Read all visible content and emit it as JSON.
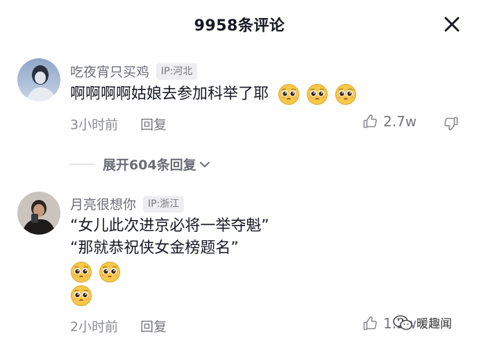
{
  "header": {
    "title": "9958条评论"
  },
  "comments": [
    {
      "username": "吃夜宵只买鸡",
      "ip": "IP:河北",
      "text": "啊啊啊啊姑娘去参加科举了耶",
      "time": "3小时前",
      "reply": "回复",
      "likes": "2.7w"
    },
    {
      "username": "月亮很想你",
      "ip": "IP:浙江",
      "line1": "“女儿此次进京必将一举夺魁”",
      "line2": "“那就恭祝侠女金榜题名”",
      "time": "2小时前",
      "reply": "回复",
      "likes": "1.2w"
    }
  ],
  "expand": {
    "label": "展开604条回复"
  },
  "watermark": {
    "text": "暖趣闻"
  },
  "icons": {
    "close": "close-icon",
    "like": "thumbs-up-icon",
    "dislike": "thumbs-down-icon",
    "emoji": "pleading-face-emoji-icon",
    "chevron": "chevron-down-icon",
    "watermark": "wechat-logo-icon"
  },
  "colors": {
    "text": "#161823",
    "secondary": "#75767e",
    "badge_bg": "#eeeef0",
    "emoji": "#f7c34a"
  }
}
